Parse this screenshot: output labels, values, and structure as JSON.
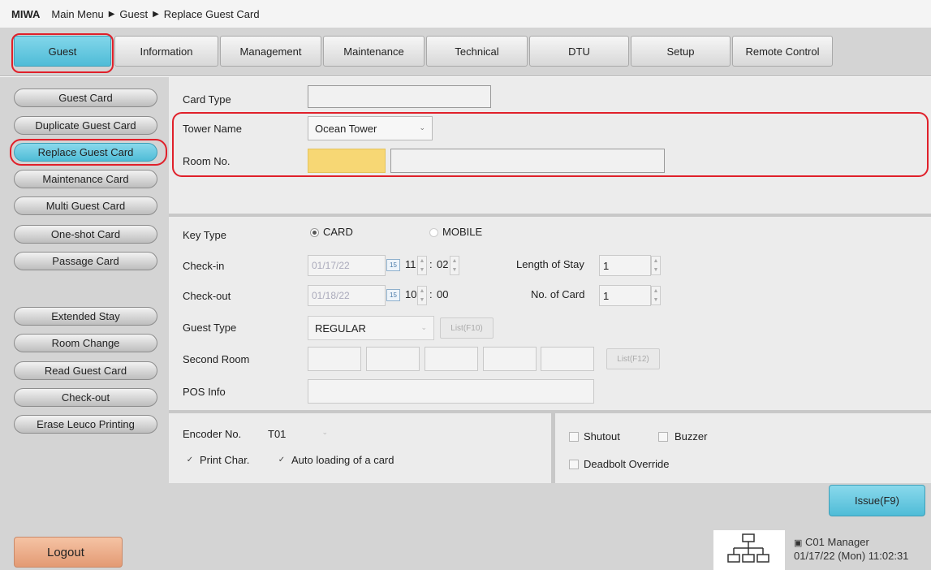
{
  "breadcrumb": {
    "brand": "MIWA",
    "items": [
      "Main Menu",
      "Guest",
      "Replace Guest Card"
    ]
  },
  "top_tabs": [
    "Guest",
    "Information",
    "Management",
    "Maintenance",
    "Technical",
    "DTU",
    "Setup",
    "Remote Control"
  ],
  "active_tab": "Guest",
  "sidebar": {
    "group1": [
      "Guest Card",
      "Duplicate Guest Card",
      "Replace Guest Card",
      "Maintenance Card",
      "Multi Guest Card",
      "One-shot Card",
      "Passage Card"
    ],
    "group2": [
      "Extended Stay",
      "Room Change",
      "Read Guest Card",
      "Check-out",
      "Erase Leuco Printing"
    ],
    "active": "Replace Guest Card"
  },
  "card_section": {
    "card_type_label": "Card Type",
    "card_type_value": "",
    "tower_name_label": "Tower Name",
    "tower_name_value": "Ocean Tower",
    "room_no_label": "Room No.",
    "room_no_value": "",
    "room_desc_value": ""
  },
  "key_section": {
    "key_type_label": "Key Type",
    "key_type_card": "CARD",
    "key_type_mobile": "MOBILE",
    "key_type_selected": "CARD",
    "checkin_label": "Check-in",
    "checkin_date": "01/17/22",
    "checkin_hour": "11",
    "checkin_minute": "02",
    "length_of_stay_label": "Length of Stay",
    "length_of_stay_value": "1",
    "checkout_label": "Check-out",
    "checkout_date": "01/18/22",
    "checkout_hour": "10",
    "checkout_minute": "00",
    "no_of_card_label": "No. of Card",
    "no_of_card_value": "1",
    "guest_type_label": "Guest Type",
    "guest_type_value": "REGULAR",
    "guest_type_list_button": "List(F10)",
    "second_room_label": "Second Room",
    "second_room_list_button": "List(F12)",
    "pos_info_label": "POS Info",
    "pos_info_value": "",
    "date_icon_text": "15",
    "time_sep": ":"
  },
  "encoder_section": {
    "encoder_no_label": "Encoder No.",
    "encoder_no_value": "T01",
    "print_char_label": "Print Char.",
    "print_char_checked": true,
    "auto_loading_label": "Auto loading of a card",
    "auto_loading_checked": true
  },
  "options_section": {
    "shutout_label": "Shutout",
    "buzzer_label": "Buzzer",
    "deadbolt_label": "Deadbolt Override"
  },
  "issue_button": "Issue(F9)",
  "footer": {
    "logout_label": "Logout",
    "terminal_user": "C01 Manager",
    "datetime": "01/17/22 (Mon) 11:02:31"
  },
  "colors": {
    "accent": "#4fbcd7",
    "highlight_red": "#e0202a",
    "room_no_fill": "#f7d774",
    "logout": "#e8a27c"
  }
}
